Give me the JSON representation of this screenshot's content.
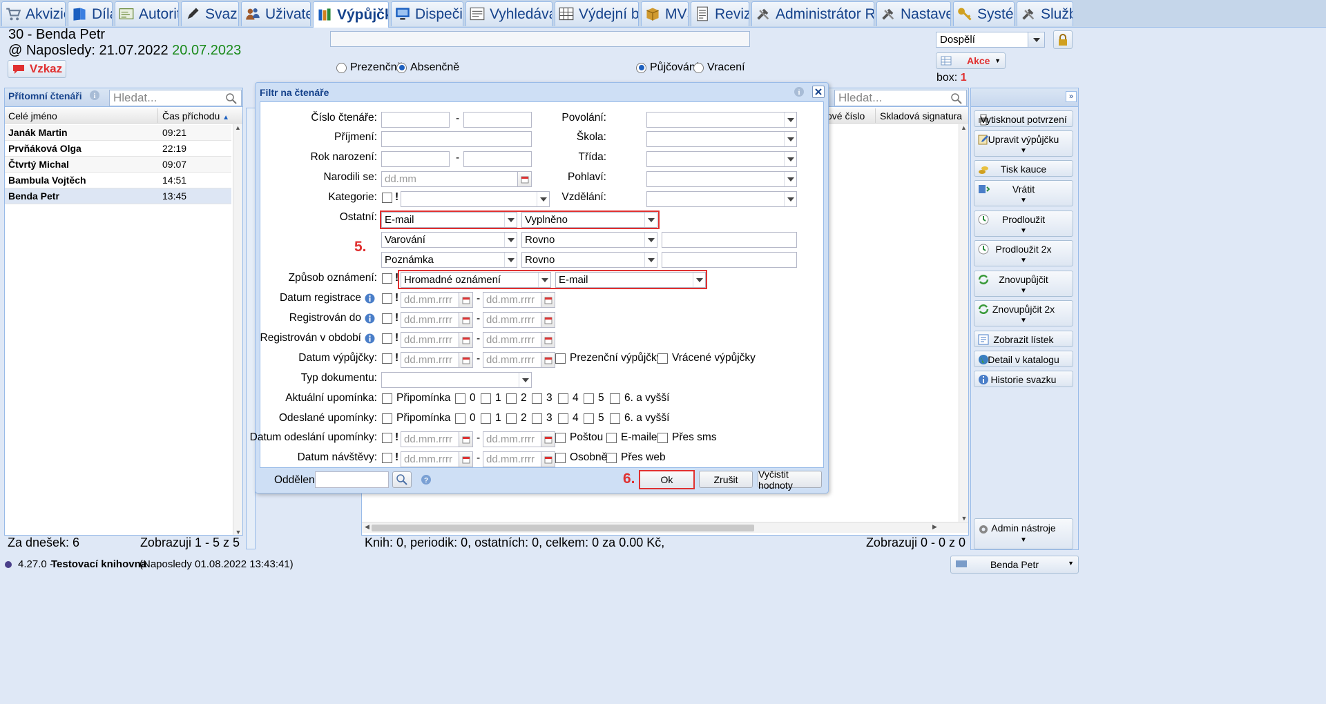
{
  "tabs": [
    {
      "label": "Akvizice",
      "icon": "cart-icon",
      "color": "#6a7d96"
    },
    {
      "label": "Díla",
      "icon": "book-icon",
      "color": "#1b5fc0"
    },
    {
      "label": "Autority",
      "icon": "card-icon",
      "color": "#6b8a3a"
    },
    {
      "label": "Svazky",
      "icon": "pen-icon",
      "color": "#333"
    },
    {
      "label": "Uživatelé",
      "icon": "users-icon",
      "color": "#a05a2c"
    },
    {
      "label": "Výpůjčky",
      "icon": "books-icon",
      "color": "#d08020"
    },
    {
      "label": "Dispečink",
      "icon": "monitor-icon",
      "color": "#1b5fc0"
    },
    {
      "label": "Vyhledávání",
      "icon": "search-box-icon",
      "color": "#666"
    },
    {
      "label": "Výdejní boxy",
      "icon": "grid-icon",
      "color": "#555"
    },
    {
      "label": "MVS",
      "icon": "package-icon",
      "color": "#d09a30"
    },
    {
      "label": "Revize",
      "icon": "document-icon",
      "color": "#666"
    },
    {
      "label": "Administrátor REKSu",
      "icon": "tools-icon",
      "color": "#555"
    },
    {
      "label": "Nastavení",
      "icon": "tools-icon",
      "color": "#555"
    },
    {
      "label": "Systém",
      "icon": "key-icon",
      "color": "#d0a020"
    },
    {
      "label": "Služba",
      "icon": "tools-icon",
      "color": "#555"
    }
  ],
  "header": {
    "reader": "30 - Benda Petr",
    "last_visit_label": "@ Naposledy: 21.07.2022",
    "last_visit_green": "20.07.2023",
    "message_button": "Vzkaz",
    "mode_radios": [
      {
        "label": "Prezenčně",
        "checked": false
      },
      {
        "label": "Absenčně",
        "checked": true
      }
    ],
    "action_radios": [
      {
        "label": "Půjčování",
        "checked": true
      },
      {
        "label": "Vracení",
        "checked": false
      }
    ],
    "category_select": "Dospělí",
    "action_button": "Akce",
    "box_label": "box:",
    "box_value": "1"
  },
  "left_panel": {
    "title": "Přítomní čtenáři",
    "search_placeholder": "Hledat...",
    "columns": [
      "Celé jméno",
      "Čas příchodu"
    ],
    "rows": [
      {
        "name": "Janák Martin",
        "time": "09:21"
      },
      {
        "name": "Prvňáková Olga",
        "time": "22:19"
      },
      {
        "name": "Čtvrtý Michal",
        "time": "09:07"
      },
      {
        "name": "Bambula Vojtěch",
        "time": "14:51"
      },
      {
        "name": "Benda Petr",
        "time": "13:45"
      }
    ],
    "footer_left": "Za dnešek: 6",
    "footer_right": "Zobrazuji 1 - 5 z 5"
  },
  "right_panel": {
    "search_placeholder": "Hledat...",
    "columns": [
      "ové číslo",
      "Skladová signatura"
    ],
    "footer_left": "Knih: 0, periodik: 0, ostatních: 0, celkem: 0 za 0.00 Kč,",
    "footer_right": "Zobrazuji 0 - 0 z 0"
  },
  "side_buttons": [
    {
      "label": "Vytisknout potvrzení",
      "icon": "print-icon",
      "dropdown": false
    },
    {
      "label": "Upravit výpůjčku",
      "icon": "edit-icon",
      "dropdown": true
    },
    {
      "label": "Tisk kauce",
      "icon": "coins-icon",
      "dropdown": false
    },
    {
      "label": "Vrátit",
      "icon": "return-icon",
      "dropdown": true
    },
    {
      "label": "Prodloužit",
      "icon": "extend-icon",
      "dropdown": true
    },
    {
      "label": "Prodloužit 2x",
      "icon": "extend-icon",
      "dropdown": true
    },
    {
      "label": "Znovupůjčit",
      "icon": "reload-icon",
      "dropdown": true
    },
    {
      "label": "Znovupůjčit 2x",
      "icon": "reload-icon",
      "dropdown": true
    },
    {
      "label": "Zobrazit lístek",
      "icon": "ticket-icon",
      "dropdown": false
    },
    {
      "label": "Detail v katalogu",
      "icon": "globe-icon",
      "dropdown": false
    },
    {
      "label": "Historie svazku",
      "icon": "info-icon",
      "dropdown": false
    }
  ],
  "admin_button": "Admin nástroje",
  "dialog": {
    "title": "Filtr na čtenáře",
    "labels": {
      "cislo": "Číslo čtenáře:",
      "prijmeni": "Příjmení:",
      "rok": "Rok narození:",
      "narodili": "Narodili se:",
      "kategorie": "Kategorie:",
      "ostatni": "Ostatní:",
      "zpusob": "Způsob oznámení:",
      "datum_reg": "Datum registrace",
      "reg_do": "Registrován do",
      "reg_obdobi": "Registrován v období",
      "datum_vyp": "Datum výpůjčky:",
      "typ_dok": "Typ dokumentu:",
      "akt_upom": "Aktuální upomínka:",
      "odesl_upom": "Odeslané upomínky:",
      "datum_odesl": "Datum odeslání upomínky:",
      "datum_navst": "Datum návštěvy:",
      "povolani": "Povolání:",
      "skola": "Škola:",
      "trida": "Třída:",
      "pohlavi": "Pohlaví:",
      "vzdelani": "Vzdělání:",
      "oddeleni": "Oddělení:"
    },
    "not": "!",
    "dash": "-",
    "date_placeholder": "dd.mm.rrrr",
    "day_placeholder": "dd.mm",
    "ostatni_rows": [
      {
        "field": "E-mail",
        "op": "Vyplněno",
        "value": ""
      },
      {
        "field": "Varování",
        "op": "Rovno",
        "value": ""
      },
      {
        "field": "Poznámka",
        "op": "Rovno",
        "value": ""
      }
    ],
    "zpusob": {
      "type": "Hromadné oznámení",
      "channel": "E-mail"
    },
    "vyp_checks": [
      "Prezenční výpůjčky",
      "Vrácené výpůjčky"
    ],
    "upom_checks": [
      "Připomínka",
      "0",
      "1",
      "2",
      "3",
      "4",
      "5",
      "6. a vyšší"
    ],
    "odesl_checks": [
      "Poštou",
      "E-mailem",
      "Přes sms"
    ],
    "navst_checks": [
      "Osobně",
      "Přes web"
    ],
    "buttons": {
      "ok": "Ok",
      "cancel": "Zrušit",
      "clear": "Vyčistit hodnoty"
    },
    "step5": "5.",
    "step6": "6."
  },
  "status_bar": {
    "version": "4.27.0 -",
    "library": "Testovací knihovna",
    "last": "(Naposledy 01.08.2022 13:43:41)",
    "user": "Benda Petr"
  },
  "colors": {
    "accent": "#15428b",
    "highlight": "#e03030",
    "green": "#1a8a1a",
    "panel_border": "#99bbe8"
  }
}
